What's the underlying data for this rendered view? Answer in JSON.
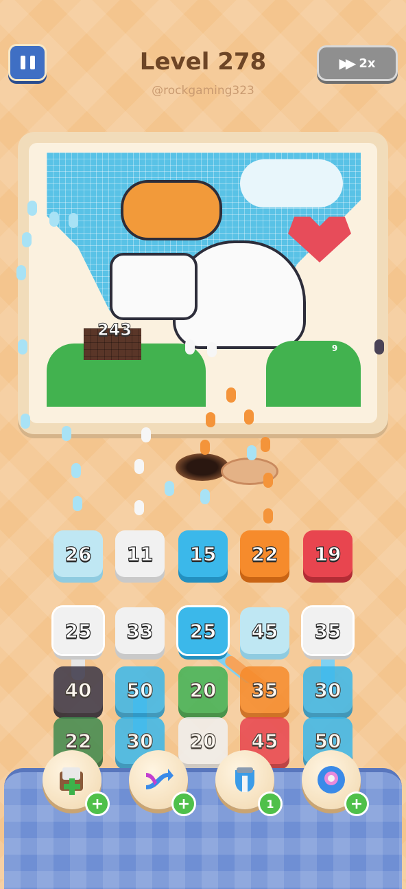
{
  "header": {
    "level_title": "Level 278",
    "username": "@rockgaming323",
    "speed_label": "2x"
  },
  "board": {
    "pixel_counter": "243",
    "small_counter": "9"
  },
  "rows": {
    "top": [
      {
        "value": "26",
        "color": "#bfe7f3"
      },
      {
        "value": "11",
        "color": "#f1f1f1"
      },
      {
        "value": "15",
        "color": "#3bb8ea"
      },
      {
        "value": "22",
        "color": "#f68b2c"
      },
      {
        "value": "19",
        "color": "#e8454f"
      }
    ],
    "row1": [
      {
        "value": "25",
        "color": "#f1f1f1"
      },
      {
        "value": "33",
        "color": "#f1f1f1"
      },
      {
        "value": "25",
        "color": "#3bb8ea"
      },
      {
        "value": "45",
        "color": "#bfe7f3"
      },
      {
        "value": "35",
        "color": "#f1f1f1"
      }
    ],
    "row2": [
      {
        "value": "40",
        "color": "#3b3748"
      },
      {
        "value": "50",
        "color": "#3bb8ea"
      },
      {
        "value": "20",
        "color": "#3fb356"
      },
      {
        "value": "35",
        "color": "#f68b2c"
      },
      {
        "value": "30",
        "color": "#3bb8ea"
      }
    ],
    "row3": [
      {
        "value": "22",
        "color": "#3f8a4e"
      },
      {
        "value": "30",
        "color": "#3bb8ea"
      },
      {
        "value": "20",
        "color": "#f1f1f1"
      },
      {
        "value": "45",
        "color": "#e8454f"
      },
      {
        "value": "50",
        "color": "#3bb8ea"
      }
    ]
  },
  "powerups": [
    {
      "name": "add-box",
      "badge": "+"
    },
    {
      "name": "shuffle",
      "badge": "+"
    },
    {
      "name": "magnet",
      "badge": "1"
    },
    {
      "name": "donut",
      "badge": "+"
    }
  ]
}
